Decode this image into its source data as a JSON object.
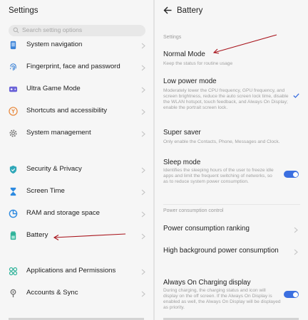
{
  "left": {
    "title": "Settings",
    "search_placeholder": "Search setting options",
    "items": [
      {
        "label": "System navigation",
        "icon": "phone-icon"
      },
      {
        "label": "Fingerprint, face and password",
        "icon": "fingerprint-icon"
      },
      {
        "label": "Ultra Game Mode",
        "icon": "gamepad-icon"
      },
      {
        "label": "Shortcuts and accessibility",
        "icon": "hand-icon"
      },
      {
        "label": "System management",
        "icon": "gear-icon"
      },
      {
        "label": "Security & Privacy",
        "icon": "shield-icon"
      },
      {
        "label": "Screen Time",
        "icon": "hourglass-icon"
      },
      {
        "label": "RAM and storage space",
        "icon": "pie-chart-icon"
      },
      {
        "label": "Battery",
        "icon": "battery-icon"
      },
      {
        "label": "Applications and Permissions",
        "icon": "apps-icon"
      },
      {
        "label": "Accounts & Sync",
        "icon": "account-icon"
      }
    ]
  },
  "right": {
    "title": "Battery",
    "section_settings": "Settings",
    "normal_mode": {
      "label": "Normal Mode",
      "desc": "Keep the status for routine usage"
    },
    "low_power": {
      "label": "Low power mode",
      "desc": "Moderately lower the CPU frequency, GPU frequency, and screen brightness, reduce the auto screen lock time, disable the WLAN hotspot, touch feedback, and Always On Display; enable the portrait screen lock."
    },
    "super_saver": {
      "label": "Super saver",
      "desc": "Only enable the Contacts, Phone, Messages and Clock."
    },
    "sleep_mode": {
      "label": "Sleep mode",
      "desc": "Identifies the sleeping hours of the user to freeze idle apps and limit the frequent switching of networks, so as to reduce system power consumption.",
      "enabled": true
    },
    "section_power": "Power consumption control",
    "ranking": {
      "label": "Power consumption ranking"
    },
    "high_bg": {
      "label": "High background power consumption"
    },
    "aod": {
      "label": "Always On Charging display",
      "desc": "During charging, the charging status and icon will display on the off screen. If the Always On Display is enabled as well, the Always On Display will be displayed as priority.",
      "enabled": true
    }
  },
  "colors": {
    "accent": "#3b6fe0",
    "icon_blue": "#3b82d6",
    "icon_orange": "#e8873a",
    "annotation_red": "#a8141c"
  }
}
